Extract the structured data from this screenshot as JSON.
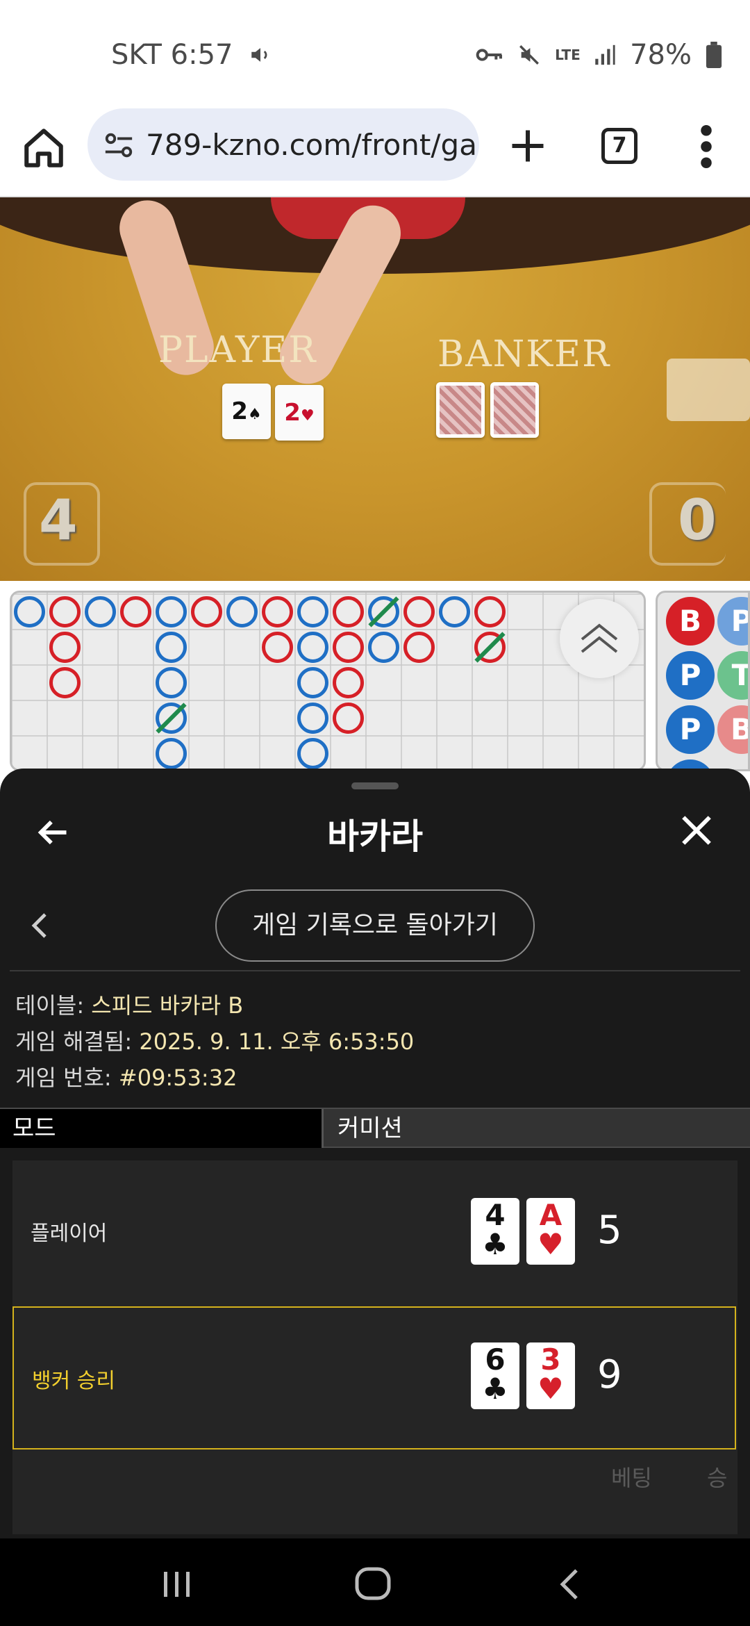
{
  "status_bar": {
    "carrier_time": "SKT 6:57",
    "network": "LTE",
    "battery": "78%"
  },
  "browser": {
    "url": "789-kzno.com/front/ga",
    "tab_count": "7"
  },
  "video": {
    "player_label": "PLAYER",
    "banker_label": "BANKER",
    "player_score": "4",
    "banker_score": "0",
    "player_cards": [
      {
        "rank": "2",
        "suit": "♠",
        "color": "#111111"
      },
      {
        "rank": "2",
        "suit": "♥",
        "color": "#c8102e"
      }
    ]
  },
  "bead_road": [
    "B",
    "P",
    "P",
    "T",
    "P",
    "B"
  ],
  "sheet": {
    "title": "바카라",
    "history_button": "게임 기록으로 돌아가기",
    "table_label": "테이블: ",
    "table_value": "스피드 바카라 B",
    "resolved_label": "게임 해결됨: ",
    "resolved_value": "2025. 9. 11. 오후 6:53:50",
    "game_no_label": "게임 번호: ",
    "game_no_value": "#09:53:32",
    "mode_header": "모드",
    "commission_header": "커미션",
    "player": {
      "label": "플레이어",
      "cards": [
        {
          "rank": "4",
          "suit": "♣",
          "color": "#111111"
        },
        {
          "rank": "A",
          "suit": "♥",
          "color": "#d6202b"
        }
      ],
      "total": "5"
    },
    "banker": {
      "label": "뱅커 승리",
      "cards": [
        {
          "rank": "6",
          "suit": "♣",
          "color": "#111111"
        },
        {
          "rank": "3",
          "suit": "♥",
          "color": "#d6202b"
        }
      ],
      "total": "9"
    },
    "footer_bet": "베팅",
    "footer_win": "승"
  },
  "colors": {
    "banker_red": "#d62027",
    "player_blue": "#1f6fc5",
    "tie_green": "#1f8a4c",
    "highlight_gold": "#d4b21c"
  },
  "icons": [
    "home-icon",
    "site-settings-icon",
    "plus-icon",
    "tabs-icon",
    "more-vert-icon",
    "back-arrow-icon",
    "close-icon",
    "chevron-left-icon",
    "chevron-up-double-icon"
  ]
}
